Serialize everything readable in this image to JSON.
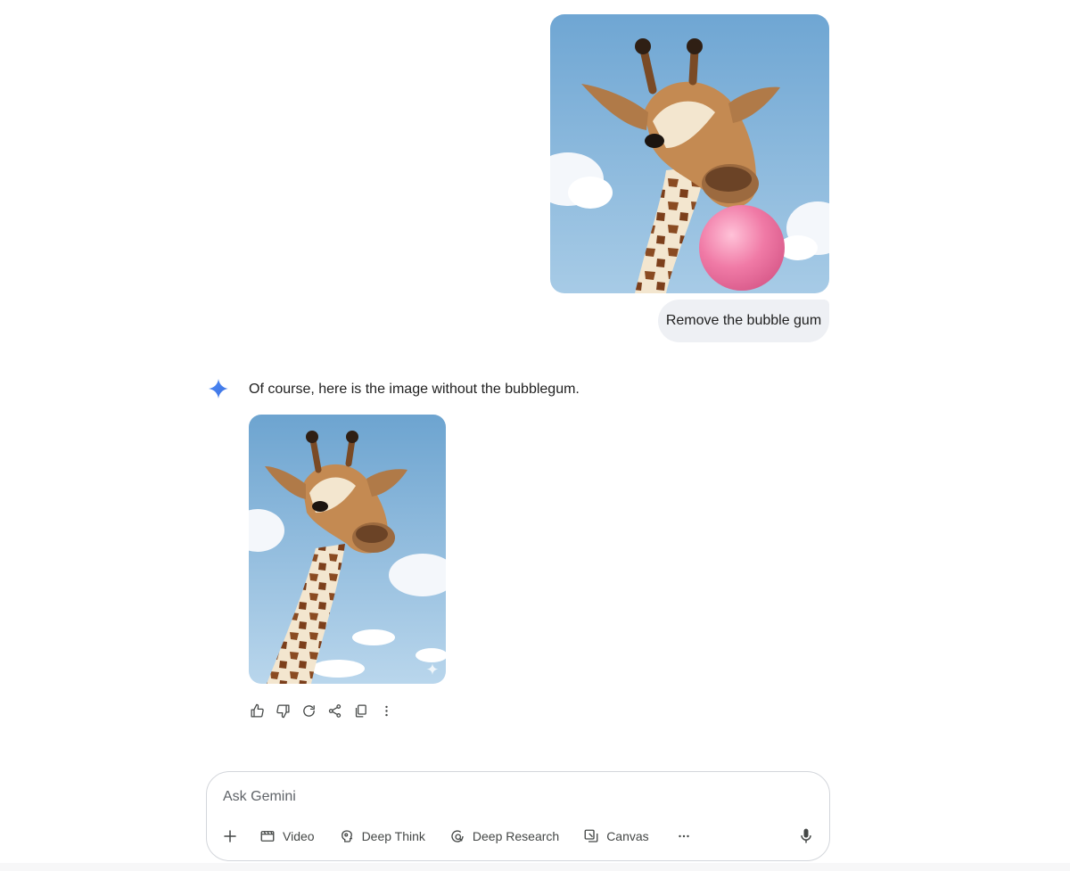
{
  "conversation": {
    "user_message": {
      "image_alt": "Giraffe blowing a pink bubble gum bubble against a blue sky",
      "text": "Remove the bubble gum"
    },
    "model_response": {
      "text": "Of course, here is the image without the bubblegum.",
      "image_alt": "Giraffe against a blue sky with clouds, without bubble gum"
    },
    "actions": [
      {
        "name": "thumbs-up-icon"
      },
      {
        "name": "thumbs-down-icon"
      },
      {
        "name": "regenerate-icon"
      },
      {
        "name": "share-icon"
      },
      {
        "name": "copy-icon"
      },
      {
        "name": "more-vertical-icon"
      }
    ]
  },
  "composer": {
    "placeholder": "Ask Gemini",
    "tools": {
      "video": "Video",
      "deep_think": "Deep Think",
      "deep_research": "Deep Research",
      "canvas": "Canvas"
    }
  },
  "colors": {
    "accent": "#4285f4",
    "bubble": "#eef0f4",
    "gum": "#f06ea0",
    "sky": "#7fb0d8"
  }
}
